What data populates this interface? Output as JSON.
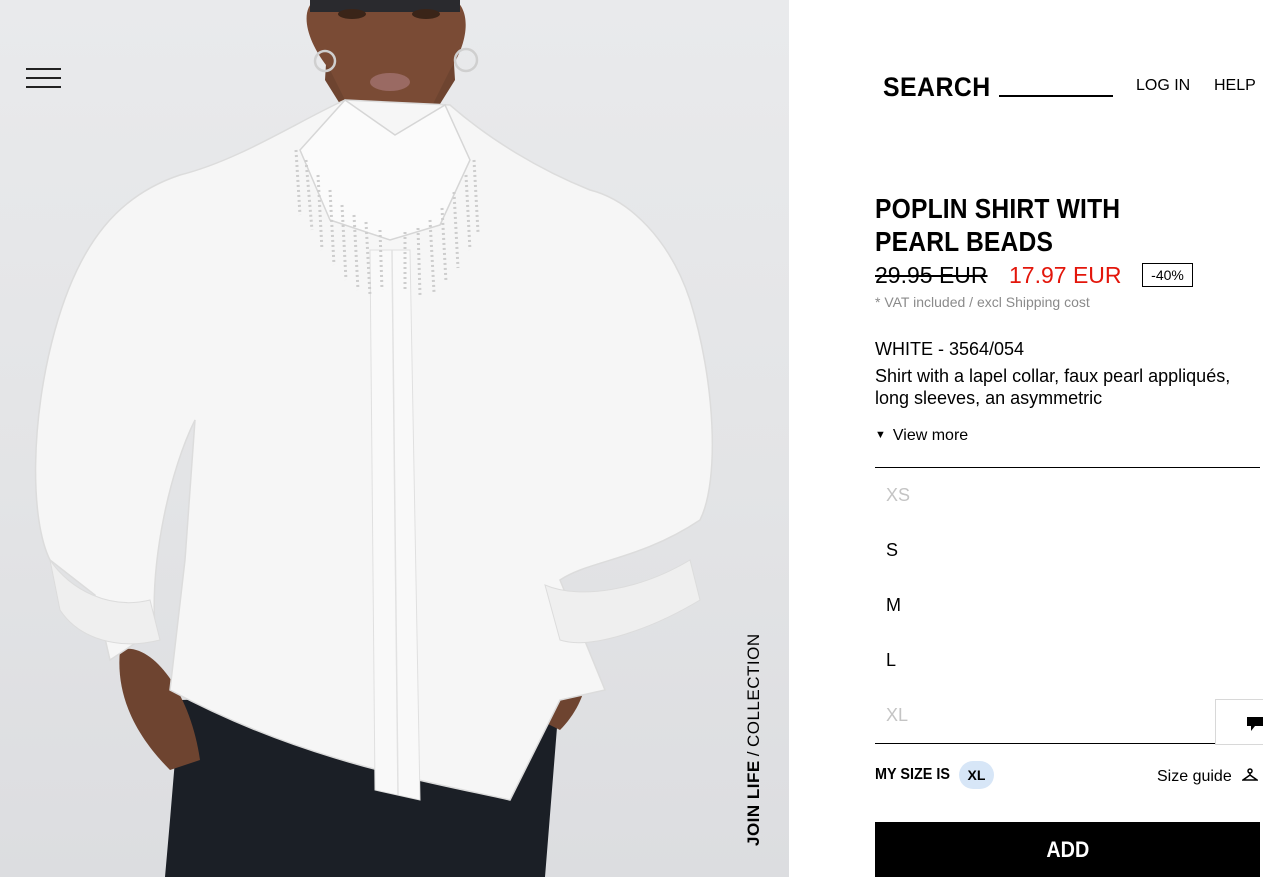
{
  "header": {
    "search_label": "SEARCH",
    "login_label": "LOG IN",
    "help_label": "HELP",
    "menu_icon": "hamburger-menu-icon"
  },
  "photo": {
    "collection_tag": {
      "bold": "JOIN LIFE",
      "separator": "/",
      "rest": "COLLECTION"
    }
  },
  "product": {
    "title": "POPLIN SHIRT WITH PEARL BEADS",
    "price_old": "29.95 EUR",
    "price_new": "17.97 EUR",
    "discount": "-40%",
    "vat_note": "* VAT included / excl Shipping cost",
    "color_ref": "WHITE - 3564/054",
    "description": "Shirt with a lapel collar, faux pearl appliqués, long sleeves, an asymmetric",
    "view_more": "View more"
  },
  "sizes": [
    {
      "label": "XS",
      "available": false
    },
    {
      "label": "S",
      "available": true
    },
    {
      "label": "M",
      "available": true
    },
    {
      "label": "L",
      "available": true
    },
    {
      "label": "XL",
      "available": false
    }
  ],
  "my_size": {
    "label": "MY SIZE IS",
    "value": "XL"
  },
  "size_guide": {
    "label": "Size guide",
    "icon": "hanger-icon"
  },
  "add_button": "ADD",
  "colors": {
    "sale_red": "#e3160b",
    "pill_blue": "#d7e6f7",
    "disabled_grey": "#c4c4c4"
  }
}
